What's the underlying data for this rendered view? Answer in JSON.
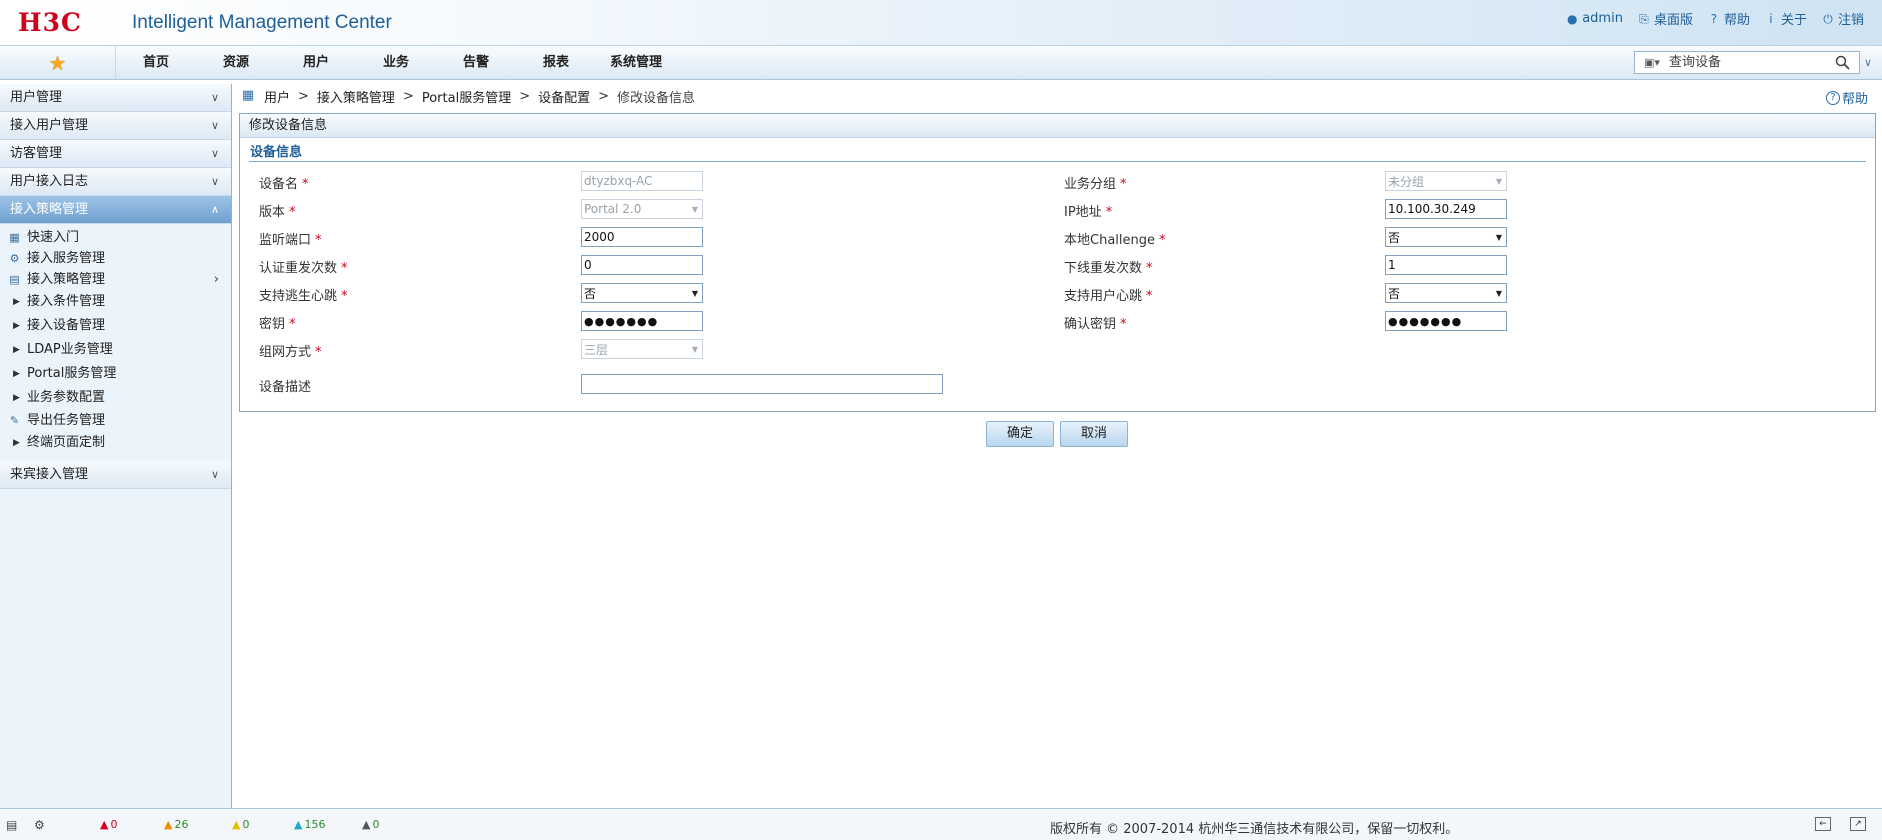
{
  "header": {
    "logo": "H3C",
    "app_title": "Intelligent Management Center",
    "links": {
      "admin": "admin",
      "desktop": "桌面版",
      "help": "帮助",
      "about": "关于",
      "logout": "注销"
    }
  },
  "nav": {
    "items": [
      "首页",
      "资源",
      "用户",
      "业务",
      "告警",
      "报表",
      "系统管理"
    ],
    "search_placeholder": "查询设备"
  },
  "sidebar": {
    "sections": {
      "s0": "用户管理",
      "s1": "接入用户管理",
      "s2": "访客管理",
      "s3": "用户接入日志",
      "s4": "接入策略管理",
      "s5": "来宾接入管理"
    },
    "subitems": {
      "quick_start": "快速入门",
      "access_service": "接入服务管理",
      "access_policy": "接入策略管理",
      "access_condition": "接入条件管理",
      "access_device": "接入设备管理",
      "ldap": "LDAP业务管理",
      "portal": "Portal服务管理",
      "business_param": "业务参数配置",
      "export_task": "导出任务管理",
      "terminal_page": "终端页面定制"
    }
  },
  "breadcrumb": {
    "b0": "用户",
    "b1": "接入策略管理",
    "b2": "Portal服务管理",
    "b3": "设备配置",
    "b4": "修改设备信息",
    "sep": ">"
  },
  "help_label": "帮助",
  "panel": {
    "title": "修改设备信息",
    "group_title": "设备信息"
  },
  "form": {
    "device_name": {
      "label": "设备名",
      "value": "dtyzbxq-AC"
    },
    "service_group": {
      "label": "业务分组",
      "value": "未分组"
    },
    "version": {
      "label": "版本",
      "value": "Portal 2.0"
    },
    "ip_address": {
      "label": "IP地址",
      "value": "10.100.30.249"
    },
    "listen_port": {
      "label": "监听端口",
      "value": "2000"
    },
    "local_challenge": {
      "label": "本地Challenge",
      "value": "否"
    },
    "auth_retry": {
      "label": "认证重发次数",
      "value": "0"
    },
    "offline_retry": {
      "label": "下线重发次数",
      "value": "1"
    },
    "escape_heartbeat": {
      "label": "支持逃生心跳",
      "value": "否"
    },
    "user_heartbeat": {
      "label": "支持用户心跳",
      "value": "否"
    },
    "key": {
      "label": "密钥",
      "value": "●●●●●●●"
    },
    "confirm_key": {
      "label": "确认密钥",
      "value": "●●●●●●●"
    },
    "network_mode": {
      "label": "组网方式",
      "value": "三层"
    },
    "description": {
      "label": "设备描述",
      "value": ""
    },
    "required_mark": "*"
  },
  "buttons": {
    "ok": "确定",
    "cancel": "取消"
  },
  "statusbar": {
    "alarm_critical": "0",
    "alarm_major": "26",
    "alarm_minor": "0",
    "alarm_warning": "156",
    "alarm_info": "0",
    "copyright": "版权所有 © 2007-2014 杭州华三通信技术有限公司，保留一切权利。"
  },
  "colors": {
    "brand_red": "#d0021b",
    "link_blue": "#1f5f99",
    "active_section": "#6f9fcf"
  }
}
